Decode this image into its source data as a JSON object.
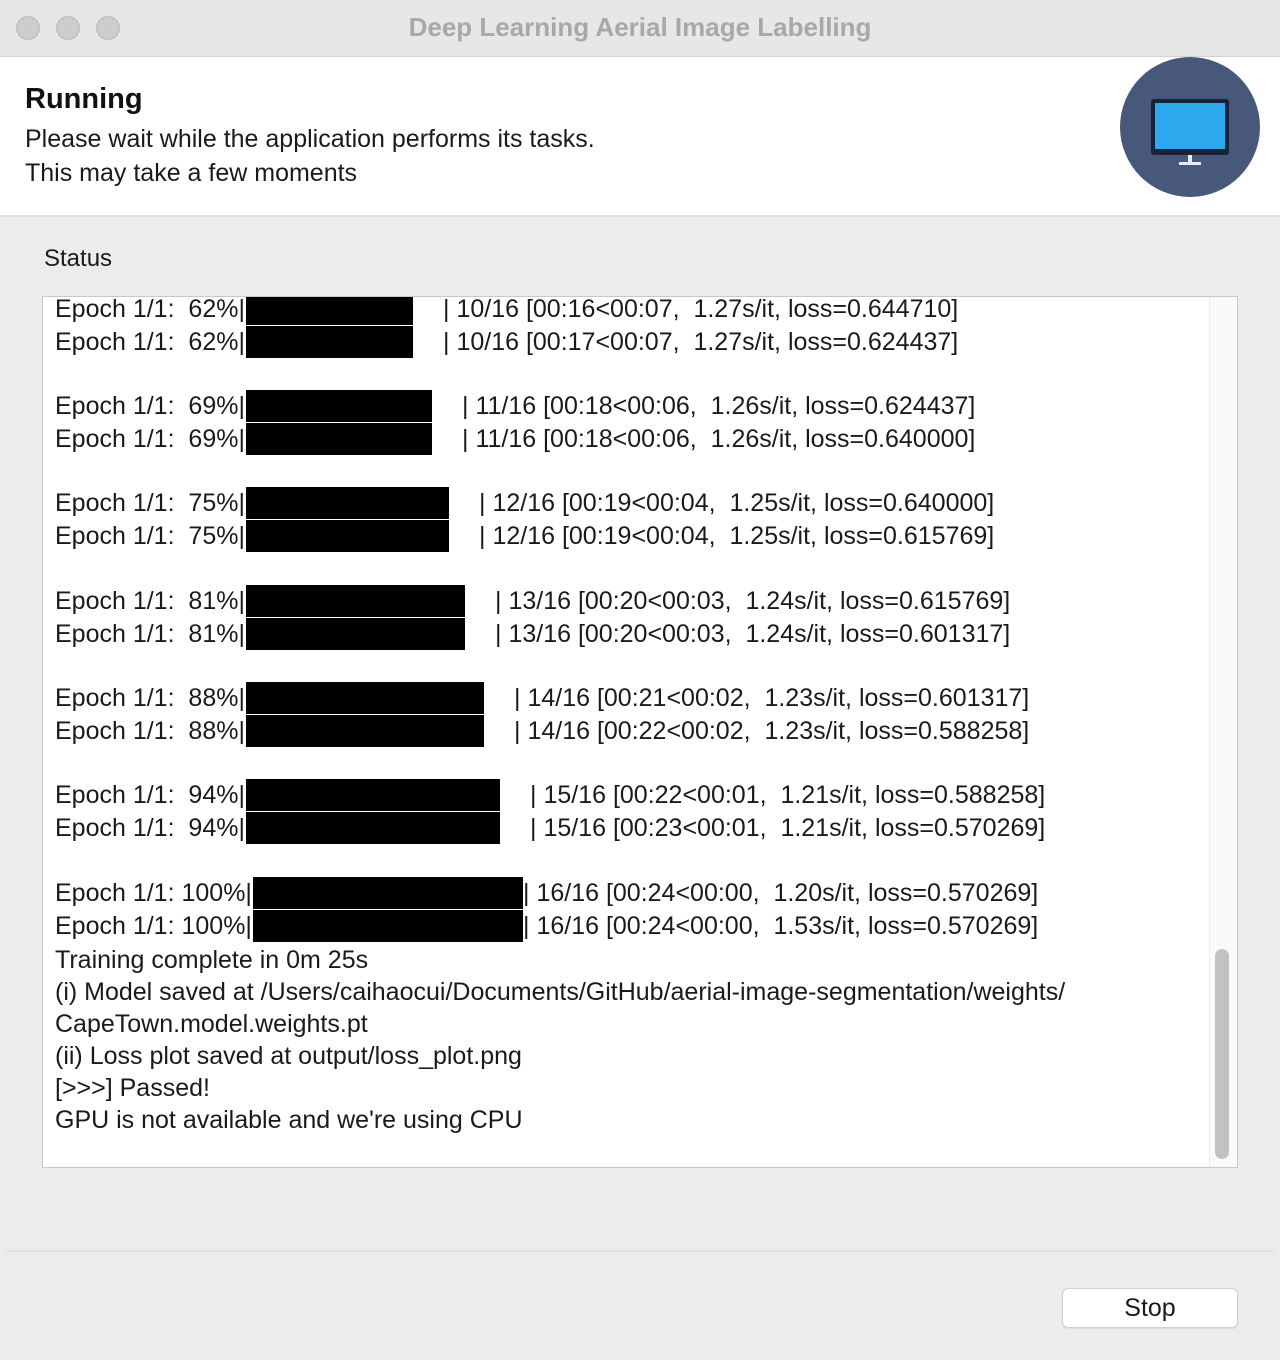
{
  "window": {
    "title": "Deep Learning Aerial Image Labelling"
  },
  "header": {
    "title": "Running",
    "line1": "Please wait while the application performs its tasks.",
    "line2": "This may take a few moments"
  },
  "status": {
    "label": "Status",
    "progress_lines": [
      {
        "prefix": "Epoch 1/1:  62%|",
        "suffix": "| 10/16 [00:16<00:07,  1.27s/it, loss=0.644710]",
        "progress": 0.62
      },
      {
        "prefix": "Epoch 1/1:  62%|",
        "suffix": "| 10/16 [00:17<00:07,  1.27s/it, loss=0.624437]",
        "progress": 0.62
      },
      {
        "prefix": "Epoch 1/1:  69%|",
        "suffix": "| 11/16 [00:18<00:06,  1.26s/it, loss=0.624437]",
        "progress": 0.69
      },
      {
        "prefix": "Epoch 1/1:  69%|",
        "suffix": "| 11/16 [00:18<00:06,  1.26s/it, loss=0.640000]",
        "progress": 0.69
      },
      {
        "prefix": "Epoch 1/1:  75%|",
        "suffix": "| 12/16 [00:19<00:04,  1.25s/it, loss=0.640000]",
        "progress": 0.75
      },
      {
        "prefix": "Epoch 1/1:  75%|",
        "suffix": "| 12/16 [00:19<00:04,  1.25s/it, loss=0.615769]",
        "progress": 0.75
      },
      {
        "prefix": "Epoch 1/1:  81%|",
        "suffix": "| 13/16 [00:20<00:03,  1.24s/it, loss=0.615769]",
        "progress": 0.81
      },
      {
        "prefix": "Epoch 1/1:  81%|",
        "suffix": "| 13/16 [00:20<00:03,  1.24s/it, loss=0.601317]",
        "progress": 0.81
      },
      {
        "prefix": "Epoch 1/1:  88%|",
        "suffix": "| 14/16 [00:21<00:02,  1.23s/it, loss=0.601317]",
        "progress": 0.88
      },
      {
        "prefix": "Epoch 1/1:  88%|",
        "suffix": "| 14/16 [00:22<00:02,  1.23s/it, loss=0.588258]",
        "progress": 0.88
      },
      {
        "prefix": "Epoch 1/1:  94%|",
        "suffix": "| 15/16 [00:22<00:01,  1.21s/it, loss=0.588258]",
        "progress": 0.94
      },
      {
        "prefix": "Epoch 1/1:  94%|",
        "suffix": "| 15/16 [00:23<00:01,  1.21s/it, loss=0.570269]",
        "progress": 0.94
      },
      {
        "prefix": "Epoch 1/1: 100%|",
        "suffix": "| 16/16 [00:24<00:00,  1.20s/it, loss=0.570269]",
        "progress": 1.0
      },
      {
        "prefix": "Epoch 1/1: 100%|",
        "suffix": "| 16/16 [00:24<00:00,  1.53s/it, loss=0.570269]",
        "progress": 1.0
      }
    ],
    "summary_lines": [
      "Training complete in 0m 25s",
      "(i) Model saved at /Users/caihaocui/Documents/GitHub/aerial-image-segmentation/weights/",
      "CapeTown.model.weights.pt",
      "(ii) Loss plot saved at output/loss_plot.png",
      "[>>>] Passed!",
      "GPU is not available and we're using CPU"
    ]
  },
  "footer": {
    "stop_label": "Stop"
  },
  "colors": {
    "icon_circle": "#48587b",
    "screen": "#2ea8ee",
    "bar": "#000000"
  },
  "icons": {
    "header_icon": "monitor-icon"
  }
}
